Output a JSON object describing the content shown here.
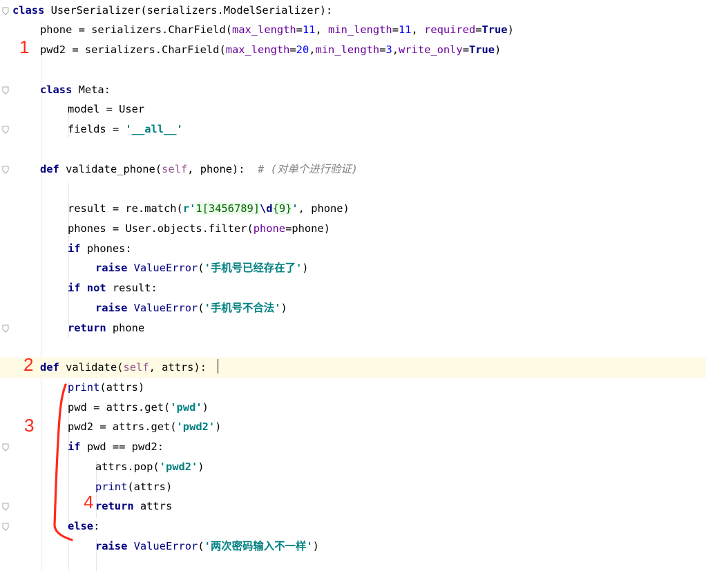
{
  "editor": {
    "lines": [
      {
        "indent": 0,
        "tokens": [
          [
            "kw",
            "class"
          ],
          [
            "plain",
            " UserSerializer(serializers.ModelSerializer):"
          ]
        ]
      },
      {
        "indent": 1,
        "tokens": [
          [
            "plain",
            "phone = serializers.CharField("
          ],
          [
            "param",
            "max_length"
          ],
          [
            "plain",
            "="
          ],
          [
            "num",
            "11"
          ],
          [
            "plain",
            ", "
          ],
          [
            "param",
            "min_length"
          ],
          [
            "plain",
            "="
          ],
          [
            "num",
            "11"
          ],
          [
            "plain",
            ", "
          ],
          [
            "param",
            "required"
          ],
          [
            "plain",
            "="
          ],
          [
            "kw",
            "True"
          ],
          [
            "plain",
            ")"
          ]
        ]
      },
      {
        "indent": 1,
        "tokens": [
          [
            "plain",
            "pwd2 = serializers.CharField("
          ],
          [
            "param",
            "max_length"
          ],
          [
            "plain",
            "="
          ],
          [
            "num",
            "20"
          ],
          [
            "plain",
            ","
          ],
          [
            "param",
            "min_length"
          ],
          [
            "plain",
            "="
          ],
          [
            "num",
            "3"
          ],
          [
            "plain",
            ","
          ],
          [
            "param",
            "write_only"
          ],
          [
            "plain",
            "="
          ],
          [
            "kw",
            "True"
          ],
          [
            "plain",
            ")"
          ]
        ]
      },
      {
        "indent": 0,
        "tokens": []
      },
      {
        "indent": 1,
        "tokens": [
          [
            "kw",
            "class"
          ],
          [
            "plain",
            " Meta:"
          ]
        ]
      },
      {
        "indent": 2,
        "tokens": [
          [
            "plain",
            "model = User"
          ]
        ]
      },
      {
        "indent": 2,
        "tokens": [
          [
            "plain",
            "fields = "
          ],
          [
            "str",
            "'__all__'"
          ]
        ]
      },
      {
        "indent": 0,
        "tokens": []
      },
      {
        "indent": 1,
        "tokens": [
          [
            "kw",
            "def"
          ],
          [
            "plain",
            " validate_phone("
          ],
          [
            "selfc",
            "self"
          ],
          [
            "plain",
            ", phone):  "
          ],
          [
            "cmt",
            "# (对单个进行验证)"
          ]
        ]
      },
      {
        "indent": 0,
        "tokens": []
      },
      {
        "indent": 2,
        "tokens": [
          [
            "plain",
            "result = re.match("
          ],
          [
            "str",
            "r'"
          ],
          [
            "rxv",
            "1[3456789]"
          ],
          [
            "esc",
            "\\d"
          ],
          [
            "rxv",
            "{9}"
          ],
          [
            "str",
            "'"
          ],
          [
            "plain",
            ", phone)"
          ]
        ]
      },
      {
        "indent": 2,
        "tokens": [
          [
            "plain",
            "phones = User.objects.filter("
          ],
          [
            "param",
            "phone"
          ],
          [
            "plain",
            "=phone)"
          ]
        ]
      },
      {
        "indent": 2,
        "tokens": [
          [
            "kw",
            "if"
          ],
          [
            "plain",
            " phones:"
          ]
        ]
      },
      {
        "indent": 3,
        "tokens": [
          [
            "kw",
            "raise"
          ],
          [
            "plain",
            " "
          ],
          [
            "fn",
            "ValueError"
          ],
          [
            "plain",
            "("
          ],
          [
            "str",
            "'手机号已经存在了'"
          ],
          [
            "plain",
            ")"
          ]
        ]
      },
      {
        "indent": 2,
        "tokens": [
          [
            "kw",
            "if not"
          ],
          [
            "plain",
            " result:"
          ]
        ]
      },
      {
        "indent": 3,
        "tokens": [
          [
            "kw",
            "raise"
          ],
          [
            "plain",
            " "
          ],
          [
            "fn",
            "ValueError"
          ],
          [
            "plain",
            "("
          ],
          [
            "str",
            "'手机号不合法'"
          ],
          [
            "plain",
            ")"
          ]
        ]
      },
      {
        "indent": 2,
        "tokens": [
          [
            "kw",
            "return"
          ],
          [
            "plain",
            " phone"
          ]
        ]
      },
      {
        "indent": 0,
        "tokens": []
      },
      {
        "indent": 1,
        "highlight": true,
        "tokens": [
          [
            "kw",
            "def"
          ],
          [
            "plain",
            " validate("
          ],
          [
            "selfc",
            "self"
          ],
          [
            "plain",
            ", attrs):"
          ]
        ]
      },
      {
        "indent": 2,
        "tokens": [
          [
            "fn",
            "print"
          ],
          [
            "plain",
            "(attrs)"
          ]
        ]
      },
      {
        "indent": 2,
        "tokens": [
          [
            "plain",
            "pwd = attrs.get("
          ],
          [
            "str",
            "'pwd'"
          ],
          [
            "plain",
            ")"
          ]
        ]
      },
      {
        "indent": 2,
        "tokens": [
          [
            "plain",
            "pwd2 = attrs.get("
          ],
          [
            "str",
            "'pwd2'"
          ],
          [
            "plain",
            ")"
          ]
        ]
      },
      {
        "indent": 2,
        "tokens": [
          [
            "kw",
            "if"
          ],
          [
            "plain",
            " pwd == pwd2:"
          ]
        ]
      },
      {
        "indent": 3,
        "tokens": [
          [
            "plain",
            "attrs.pop("
          ],
          [
            "str",
            "'pwd2'"
          ],
          [
            "plain",
            ")"
          ]
        ]
      },
      {
        "indent": 3,
        "tokens": [
          [
            "fn",
            "print"
          ],
          [
            "plain",
            "(attrs)"
          ]
        ]
      },
      {
        "indent": 3,
        "tokens": [
          [
            "kw",
            "return"
          ],
          [
            "plain",
            " attrs"
          ]
        ]
      },
      {
        "indent": 2,
        "tokens": [
          [
            "kw",
            "else"
          ],
          [
            "plain",
            ":"
          ]
        ]
      },
      {
        "indent": 3,
        "tokens": [
          [
            "kw",
            "raise"
          ],
          [
            "plain",
            " "
          ],
          [
            "fn",
            "ValueError"
          ],
          [
            "plain",
            "("
          ],
          [
            "str",
            "'两次密码输入不一样'"
          ],
          [
            "plain",
            ")"
          ]
        ]
      }
    ]
  },
  "annotations": [
    {
      "label": "1",
      "line": 2
    },
    {
      "label": "2",
      "line": 18
    },
    {
      "label": "3",
      "line": 21
    },
    {
      "label": "4",
      "line": 25
    }
  ],
  "colors": {
    "keyword": "#000080",
    "string": "#008080",
    "number": "#0000ff",
    "named_param": "#660099",
    "self": "#94558d",
    "comment": "#808080",
    "annotation": "#ff2a1a",
    "current_line": "#fffae3"
  }
}
